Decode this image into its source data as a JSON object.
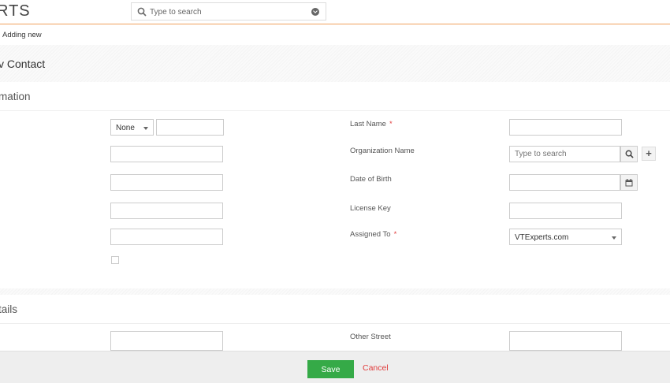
{
  "header": {
    "logo_text": "RTS",
    "search_placeholder": "Type to search"
  },
  "breadcrumb": "Adding new",
  "page_title": "v Contact",
  "sections": {
    "basic": "mation",
    "address": "tails"
  },
  "form": {
    "salutation_value": "None",
    "last_name_label": "Last Name",
    "org_name_label": "Organization Name",
    "org_search_placeholder": "Type to search",
    "dob_label": "Date of Birth",
    "license_key_label": "License Key",
    "assigned_to_label": "Assigned To",
    "assigned_to_value": "VTExperts.com",
    "other_street_label": "Other Street",
    "required_marker": "*"
  },
  "footer": {
    "save_label": "Save",
    "cancel_label": "Cancel"
  },
  "colors": {
    "accent_orange": "#f0a15b",
    "save_green": "#35aa47",
    "cancel_red": "#e03c3c"
  }
}
